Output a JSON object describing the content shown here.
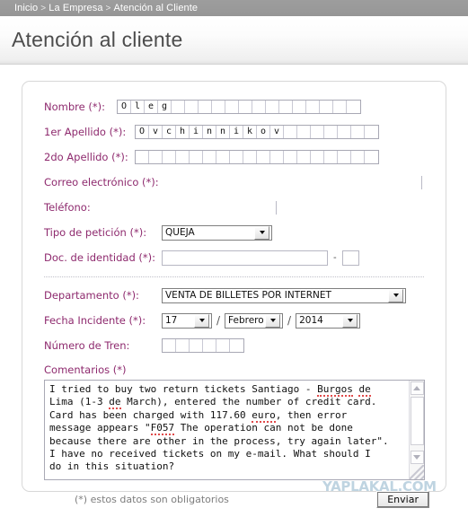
{
  "breadcrumb": {
    "items": [
      "Inicio",
      "La Empresa",
      "Atención al Cliente"
    ],
    "separator": ">"
  },
  "header": {
    "title": "Atención al cliente"
  },
  "form": {
    "fields": {
      "nombre": {
        "label": "Nombre (*):",
        "type": "comb",
        "cells": 18,
        "value": "Oleg"
      },
      "apellido1": {
        "label": "1er Apellido (*):",
        "type": "comb",
        "cells": 18,
        "value": "Ovchinnikov"
      },
      "apellido2": {
        "label": "2do Apellido (*):",
        "type": "comb",
        "cells": 18,
        "value": ""
      },
      "correo": {
        "label": "Correo electrónico (*):",
        "type": "text",
        "value": ""
      },
      "telefono": {
        "label": "Teléfono:",
        "type": "text",
        "value": ""
      },
      "tipo_peticion": {
        "label": "Tipo de petición (*):",
        "type": "select",
        "value": "QUEJA"
      },
      "doc_identidad": {
        "label": "Doc. de identidad (*):",
        "type": "text",
        "value": "",
        "separator": "-",
        "check_value": ""
      },
      "departamento": {
        "label": "Departamento (*):",
        "type": "select",
        "value": "VENTA DE BILLETES POR INTERNET"
      },
      "fecha_incidente": {
        "label": "Fecha Incidente (*):",
        "type": "date",
        "day": "17",
        "month": "Febrero",
        "year": "2014",
        "separator": "/"
      },
      "numero_tren": {
        "label": "Número de Tren:",
        "type": "comb",
        "cells": 6,
        "value": ""
      },
      "comentarios": {
        "label": "Comentarios (*)",
        "type": "textarea",
        "lines": [
          "I tried to buy two return tickets Santiago - Burgos de",
          "Lima (1-3 de March), entered the number of credit card.",
          "Card has been charged with 117.60 euro, then error",
          "message appears \"F057 The operation can not be done",
          "because there are other in the process, try again later\".",
          "I have no received tickets on my e-mail. What should I",
          "do in this situation?"
        ],
        "misspelled": [
          "Burgos",
          "de",
          "euro",
          "F057"
        ]
      }
    }
  },
  "footer": {
    "required_note": "(*) estos datos son obligatorios",
    "submit_label": "Enviar"
  },
  "watermark": {
    "text": "YAPLAKAL.COM"
  },
  "colors": {
    "label": "#8e2a6e",
    "breadcrumb_bar": "#9a9a9a",
    "title_text": "#4c4c4c",
    "panel_border": "#d8d8d8",
    "spellcheck_underline": "#e04a4a",
    "watermark": "#bcd2e0"
  }
}
